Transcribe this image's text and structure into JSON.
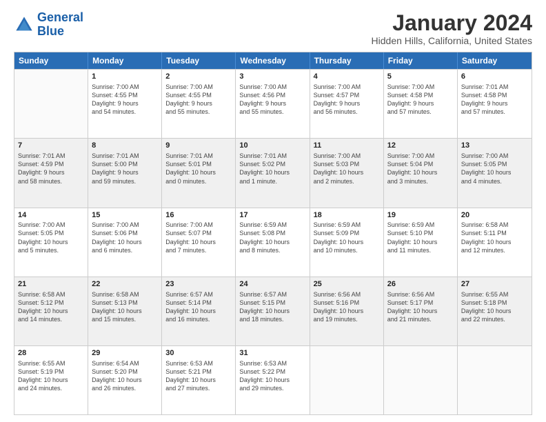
{
  "logo": {
    "line1": "General",
    "line2": "Blue"
  },
  "title": "January 2024",
  "subtitle": "Hidden Hills, California, United States",
  "days_of_week": [
    "Sunday",
    "Monday",
    "Tuesday",
    "Wednesday",
    "Thursday",
    "Friday",
    "Saturday"
  ],
  "weeks": [
    [
      {
        "day": "",
        "empty": true,
        "shaded": false
      },
      {
        "day": "1",
        "info": "Sunrise: 7:00 AM\nSunset: 4:55 PM\nDaylight: 9 hours\nand 54 minutes.",
        "shaded": false
      },
      {
        "day": "2",
        "info": "Sunrise: 7:00 AM\nSunset: 4:55 PM\nDaylight: 9 hours\nand 55 minutes.",
        "shaded": false
      },
      {
        "day": "3",
        "info": "Sunrise: 7:00 AM\nSunset: 4:56 PM\nDaylight: 9 hours\nand 55 minutes.",
        "shaded": false
      },
      {
        "day": "4",
        "info": "Sunrise: 7:00 AM\nSunset: 4:57 PM\nDaylight: 9 hours\nand 56 minutes.",
        "shaded": false
      },
      {
        "day": "5",
        "info": "Sunrise: 7:00 AM\nSunset: 4:58 PM\nDaylight: 9 hours\nand 57 minutes.",
        "shaded": false
      },
      {
        "day": "6",
        "info": "Sunrise: 7:01 AM\nSunset: 4:58 PM\nDaylight: 9 hours\nand 57 minutes.",
        "shaded": false
      }
    ],
    [
      {
        "day": "7",
        "info": "Sunrise: 7:01 AM\nSunset: 4:59 PM\nDaylight: 9 hours\nand 58 minutes.",
        "shaded": true
      },
      {
        "day": "8",
        "info": "Sunrise: 7:01 AM\nSunset: 5:00 PM\nDaylight: 9 hours\nand 59 minutes.",
        "shaded": true
      },
      {
        "day": "9",
        "info": "Sunrise: 7:01 AM\nSunset: 5:01 PM\nDaylight: 10 hours\nand 0 minutes.",
        "shaded": true
      },
      {
        "day": "10",
        "info": "Sunrise: 7:01 AM\nSunset: 5:02 PM\nDaylight: 10 hours\nand 1 minute.",
        "shaded": true
      },
      {
        "day": "11",
        "info": "Sunrise: 7:00 AM\nSunset: 5:03 PM\nDaylight: 10 hours\nand 2 minutes.",
        "shaded": true
      },
      {
        "day": "12",
        "info": "Sunrise: 7:00 AM\nSunset: 5:04 PM\nDaylight: 10 hours\nand 3 minutes.",
        "shaded": true
      },
      {
        "day": "13",
        "info": "Sunrise: 7:00 AM\nSunset: 5:05 PM\nDaylight: 10 hours\nand 4 minutes.",
        "shaded": true
      }
    ],
    [
      {
        "day": "14",
        "info": "Sunrise: 7:00 AM\nSunset: 5:05 PM\nDaylight: 10 hours\nand 5 minutes.",
        "shaded": false
      },
      {
        "day": "15",
        "info": "Sunrise: 7:00 AM\nSunset: 5:06 PM\nDaylight: 10 hours\nand 6 minutes.",
        "shaded": false
      },
      {
        "day": "16",
        "info": "Sunrise: 7:00 AM\nSunset: 5:07 PM\nDaylight: 10 hours\nand 7 minutes.",
        "shaded": false
      },
      {
        "day": "17",
        "info": "Sunrise: 6:59 AM\nSunset: 5:08 PM\nDaylight: 10 hours\nand 8 minutes.",
        "shaded": false
      },
      {
        "day": "18",
        "info": "Sunrise: 6:59 AM\nSunset: 5:09 PM\nDaylight: 10 hours\nand 10 minutes.",
        "shaded": false
      },
      {
        "day": "19",
        "info": "Sunrise: 6:59 AM\nSunset: 5:10 PM\nDaylight: 10 hours\nand 11 minutes.",
        "shaded": false
      },
      {
        "day": "20",
        "info": "Sunrise: 6:58 AM\nSunset: 5:11 PM\nDaylight: 10 hours\nand 12 minutes.",
        "shaded": false
      }
    ],
    [
      {
        "day": "21",
        "info": "Sunrise: 6:58 AM\nSunset: 5:12 PM\nDaylight: 10 hours\nand 14 minutes.",
        "shaded": true
      },
      {
        "day": "22",
        "info": "Sunrise: 6:58 AM\nSunset: 5:13 PM\nDaylight: 10 hours\nand 15 minutes.",
        "shaded": true
      },
      {
        "day": "23",
        "info": "Sunrise: 6:57 AM\nSunset: 5:14 PM\nDaylight: 10 hours\nand 16 minutes.",
        "shaded": true
      },
      {
        "day": "24",
        "info": "Sunrise: 6:57 AM\nSunset: 5:15 PM\nDaylight: 10 hours\nand 18 minutes.",
        "shaded": true
      },
      {
        "day": "25",
        "info": "Sunrise: 6:56 AM\nSunset: 5:16 PM\nDaylight: 10 hours\nand 19 minutes.",
        "shaded": true
      },
      {
        "day": "26",
        "info": "Sunrise: 6:56 AM\nSunset: 5:17 PM\nDaylight: 10 hours\nand 21 minutes.",
        "shaded": true
      },
      {
        "day": "27",
        "info": "Sunrise: 6:55 AM\nSunset: 5:18 PM\nDaylight: 10 hours\nand 22 minutes.",
        "shaded": true
      }
    ],
    [
      {
        "day": "28",
        "info": "Sunrise: 6:55 AM\nSunset: 5:19 PM\nDaylight: 10 hours\nand 24 minutes.",
        "shaded": false
      },
      {
        "day": "29",
        "info": "Sunrise: 6:54 AM\nSunset: 5:20 PM\nDaylight: 10 hours\nand 26 minutes.",
        "shaded": false
      },
      {
        "day": "30",
        "info": "Sunrise: 6:53 AM\nSunset: 5:21 PM\nDaylight: 10 hours\nand 27 minutes.",
        "shaded": false
      },
      {
        "day": "31",
        "info": "Sunrise: 6:53 AM\nSunset: 5:22 PM\nDaylight: 10 hours\nand 29 minutes.",
        "shaded": false
      },
      {
        "day": "",
        "empty": true,
        "shaded": false
      },
      {
        "day": "",
        "empty": true,
        "shaded": false
      },
      {
        "day": "",
        "empty": true,
        "shaded": false
      }
    ]
  ]
}
